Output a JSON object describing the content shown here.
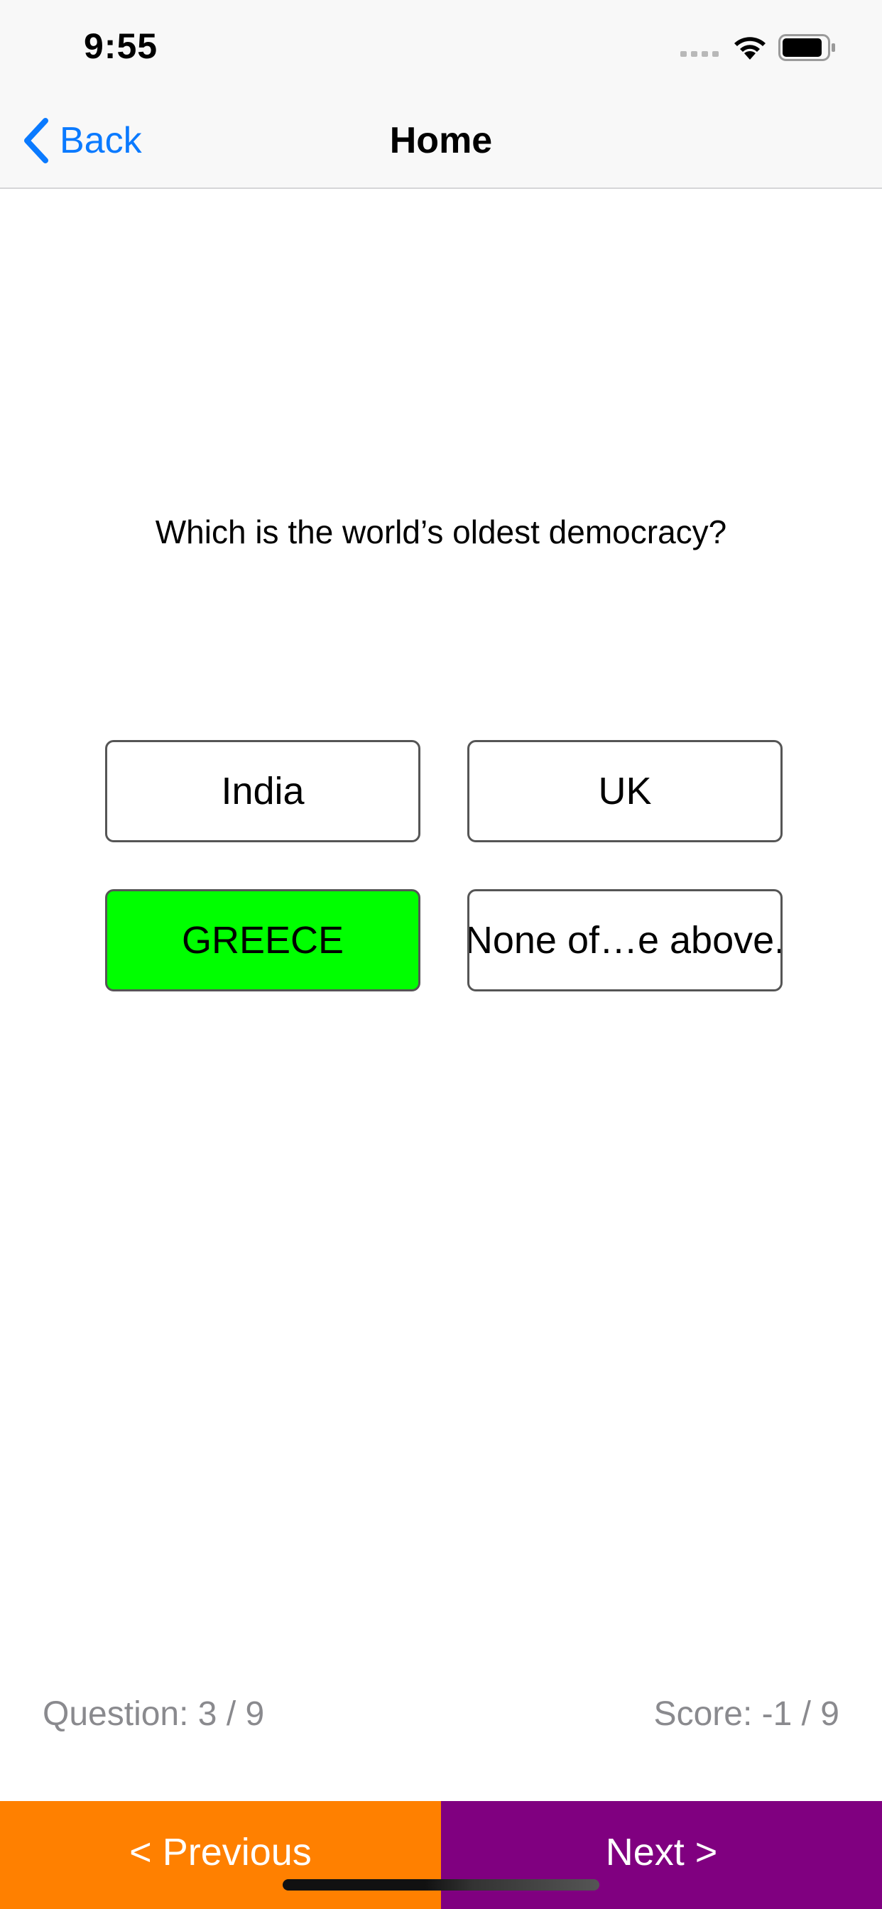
{
  "status_bar": {
    "time": "9:55",
    "icons": [
      "signal-icon",
      "wifi-icon",
      "battery-icon"
    ]
  },
  "nav": {
    "back_label": "Back",
    "back_icon": "chevron-left-icon",
    "title": "Home"
  },
  "quiz": {
    "question": "Which is the world’s oldest democracy?",
    "options": [
      {
        "label": "India",
        "selected": false
      },
      {
        "label": "UK",
        "selected": false
      },
      {
        "label": "GREECE",
        "selected": true
      },
      {
        "label": "None of…e above.",
        "selected": false
      }
    ],
    "progress": "Question: 3 / 9",
    "score": "Score: -1 / 9"
  },
  "footer": {
    "previous_label": "< Previous",
    "next_label": "Next >"
  },
  "colors": {
    "accent": "#0a7aff",
    "selected_answer": "#00ff00",
    "previous_bg": "#ff8000",
    "next_bg": "#800080",
    "muted_text": "#8a8a8e"
  }
}
